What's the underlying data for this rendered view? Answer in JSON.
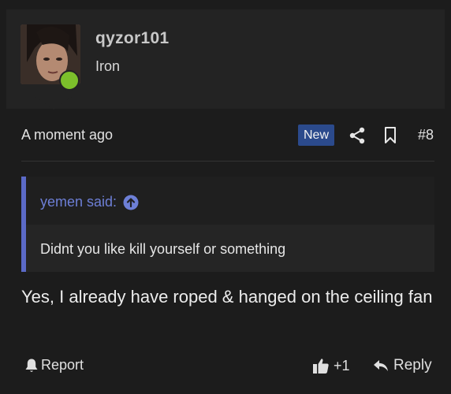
{
  "user": {
    "username": "qyzor101",
    "title": "Iron",
    "online_color": "#7cc02b"
  },
  "post": {
    "timestamp": "A moment ago",
    "badge": "New",
    "number": "#8",
    "quote": {
      "author_label": "yemen said:",
      "text": "Didnt you like kill yourself or something"
    },
    "message": "Yes, I already have roped & hanged on the ceiling fan"
  },
  "actions": {
    "report": "Report",
    "like_count": "+1",
    "reply": "Reply"
  },
  "icons": [
    "share-icon",
    "bookmark-icon",
    "arrow-up-circle-icon",
    "bell-icon",
    "thumbs-up-icon",
    "reply-arrow-icon"
  ]
}
